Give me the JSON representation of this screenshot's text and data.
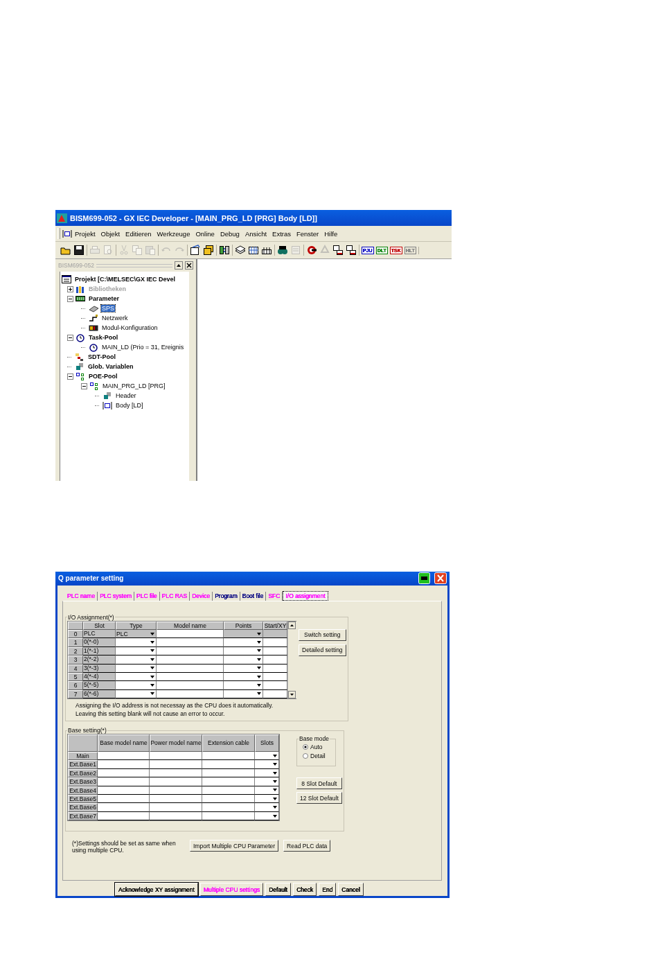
{
  "ide_window": {
    "title": "BISM699-052 - GX IEC Developer - [MAIN_PRG_LD [PRG] Body [LD]]",
    "menu": [
      "Projekt",
      "Objekt",
      "Editieren",
      "Werkzeuge",
      "Online",
      "Debug",
      "Ansicht",
      "Extras",
      "Fenster",
      "Hilfe"
    ],
    "toolbar": [
      {
        "buttons": [
          {
            "disabled": false
          },
          {
            "disabled": false
          }
        ]
      },
      {
        "buttons": [
          {
            "disabled": true
          },
          {
            "disabled": true
          }
        ]
      },
      {
        "buttons": [
          {
            "disabled": true
          },
          {
            "disabled": true
          },
          {
            "disabled": true
          }
        ]
      },
      {
        "buttons": [
          {
            "disabled": true
          },
          {
            "disabled": true
          }
        ]
      },
      {
        "buttons": [
          {
            "disabled": false
          },
          {
            "disabled": false
          }
        ]
      },
      {
        "buttons": [
          {
            "disabled": false
          }
        ]
      },
      {
        "buttons": [
          {
            "disabled": false
          },
          {
            "disabled": false
          },
          {
            "disabled": false
          }
        ]
      },
      {
        "buttons": [
          {
            "disabled": false
          },
          {
            "disabled": true
          }
        ]
      },
      {
        "buttons": [
          {
            "disabled": false
          },
          {
            "disabled": true
          },
          {
            "disabled": false
          },
          {
            "disabled": false
          }
        ]
      },
      {
        "buttons": [
          {
            "label": "PJU",
            "color": "#0000c0",
            "disabled": false
          },
          {
            "label": "DLT",
            "color": "#008000",
            "disabled": false
          },
          {
            "label": "TSK",
            "color": "#c00000",
            "disabled": false
          },
          {
            "label": "HLT",
            "color": "#808080",
            "disabled": true
          }
        ]
      }
    ],
    "pane_title": "BISM699-052",
    "tree": [
      {
        "label": "Projekt [C:\\MELSEC\\GX IEC Devel",
        "kind": "project",
        "selected": false,
        "disabled": false,
        "children": [
          {
            "label": "Bibliotheken",
            "kind": "library",
            "expanded": false,
            "selected": false,
            "disabled": true
          },
          {
            "label": "Parameter",
            "kind": "parameter",
            "expanded": true,
            "selected": false,
            "disabled": false,
            "children": [
              {
                "label": "SPS",
                "kind": "plc",
                "selected": true,
                "disabled": false
              },
              {
                "label": "Netzwerk",
                "kind": "network",
                "selected": false,
                "disabled": false
              },
              {
                "label": "Modul-Konfiguration",
                "kind": "module",
                "selected": false,
                "disabled": false
              }
            ]
          },
          {
            "label": "Task-Pool",
            "kind": "task-pool",
            "expanded": true,
            "selected": false,
            "disabled": false,
            "children": [
              {
                "label": "MAIN_LD (Prio = 31, Ereignis",
                "kind": "task",
                "selected": false,
                "disabled": false
              }
            ]
          },
          {
            "label": "SDT-Pool",
            "kind": "sdt-pool",
            "selected": false,
            "disabled": false
          },
          {
            "label": "Glob. Variablen",
            "kind": "globals",
            "selected": false,
            "disabled": false
          },
          {
            "label": "POE-Pool",
            "kind": "poe-pool",
            "expanded": true,
            "selected": false,
            "disabled": false,
            "children": [
              {
                "label": "MAIN_PRG_LD [PRG]",
                "kind": "program",
                "expanded": true,
                "selected": false,
                "disabled": false,
                "children": [
                  {
                    "label": "Header",
                    "kind": "header",
                    "selected": false,
                    "disabled": false
                  },
                  {
                    "label": "Body [LD]",
                    "kind": "body",
                    "selected": false,
                    "disabled": false
                  }
                ]
              }
            ]
          }
        ]
      }
    ]
  },
  "dialog": {
    "title": "Q parameter setting",
    "tabs": [
      {
        "label": "PLC name",
        "color": "#ff00ff",
        "selected": false
      },
      {
        "label": "PLC system",
        "color": "#ff00ff",
        "selected": false
      },
      {
        "label": "PLC file",
        "color": "#ff00ff",
        "selected": false
      },
      {
        "label": "PLC RAS",
        "color": "#ff00ff",
        "selected": false
      },
      {
        "label": "Device",
        "color": "#ff00ff",
        "selected": false
      },
      {
        "label": "Program",
        "color": "#000080",
        "selected": false
      },
      {
        "label": "Boot file",
        "color": "#000080",
        "selected": false
      },
      {
        "label": "SFC",
        "color": "#ff00ff",
        "selected": false
      },
      {
        "label": "I/O assignment",
        "color": "#ff00ff",
        "selected": true
      }
    ],
    "io_assignment": {
      "legend": "I/O Assignment(*)",
      "columns": [
        "Slot",
        "Type",
        "Model name",
        "Points",
        "Start/XY"
      ],
      "rows": [
        {
          "index": "0",
          "slot": "PLC",
          "type": "PLC",
          "disabled": true
        },
        {
          "index": "1",
          "slot": "0(*-0)",
          "disabled": false
        },
        {
          "index": "2",
          "slot": "1(*-1)",
          "disabled": false
        },
        {
          "index": "3",
          "slot": "2(*-2)",
          "disabled": false
        },
        {
          "index": "4",
          "slot": "3(*-3)",
          "disabled": false
        },
        {
          "index": "5",
          "slot": "4(*-4)",
          "disabled": false
        },
        {
          "index": "6",
          "slot": "5(*-5)",
          "disabled": false
        },
        {
          "index": "7",
          "slot": "6(*-6)",
          "disabled": false
        }
      ],
      "buttons": [
        "Switch setting",
        "Detailed setting"
      ],
      "notes": [
        "Assigning the I/O address is not necessay as the CPU does it automatically.",
        "Leaving this setting blank will not cause an error to occur."
      ]
    },
    "base_setting": {
      "legend": "Base setting(*)",
      "columns": [
        "Base model name",
        "Power model name",
        "Extension cable",
        "Slots"
      ],
      "rows": [
        "Main",
        "Ext.Base1",
        "Ext.Base2",
        "Ext.Base3",
        "Ext.Base4",
        "Ext.Base5",
        "Ext.Base6",
        "Ext.Base7"
      ],
      "base_mode": {
        "legend": "Base mode",
        "options": [
          {
            "label": "Auto",
            "selected": true
          },
          {
            "label": "Detail",
            "selected": false
          }
        ]
      },
      "buttons": [
        "8 Slot Default",
        "12 Slot Default"
      ]
    },
    "footnote": "(*)Settings should be set as same when using multiple CPU.",
    "action_buttons": [
      "Import Multiple CPU Parameter",
      "Read PLC data"
    ],
    "footer_buttons": [
      {
        "label": "Acknowledge XY assignment",
        "color": "#000000",
        "focused": true
      },
      {
        "label": "Multiple CPU settings",
        "color": "#ff00ff",
        "focused": false
      },
      {
        "label": "Default",
        "color": "#000000",
        "focused": false
      },
      {
        "label": "Check",
        "color": "#000000",
        "focused": false
      },
      {
        "label": "End",
        "color": "#000000",
        "focused": false
      },
      {
        "label": "Cancel",
        "color": "#000000",
        "focused": false
      }
    ]
  }
}
